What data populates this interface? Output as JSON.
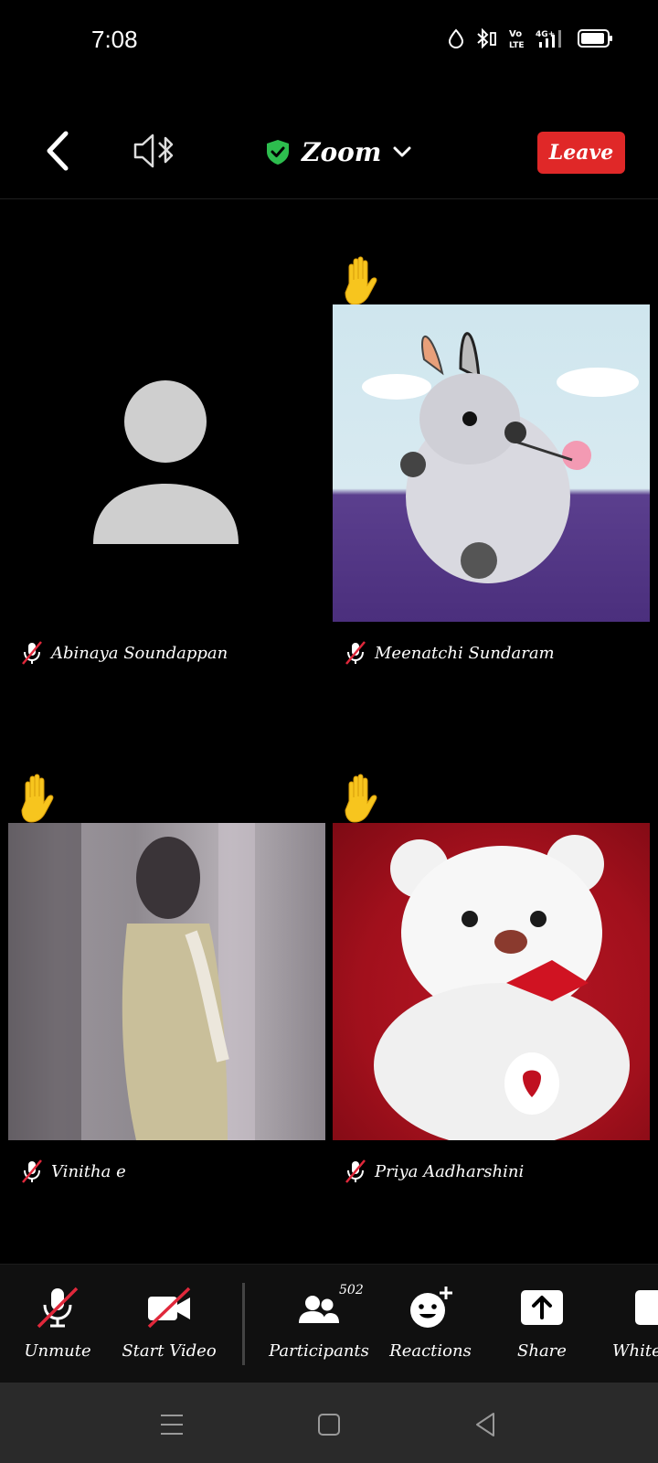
{
  "status": {
    "time": "7:08",
    "icons": [
      "data-saver-icon",
      "bluetooth-icon",
      "volte-icon",
      "4g-signal-icon",
      "battery-icon"
    ]
  },
  "toolbar": {
    "meeting_title": "Zoom",
    "leave_label": "Leave",
    "icons": [
      "back-arrow-icon",
      "bluetooth-speaker-icon",
      "shield-check-icon",
      "chevron-down-icon"
    ],
    "shield_color": "#2dbd4e",
    "leave_color": "#e02828"
  },
  "participants": [
    {
      "name": "Abinaya Soundappan",
      "muted": true,
      "hand_raised": false,
      "video": "avatar-placeholder"
    },
    {
      "name": "Meenatchi Sundaram",
      "muted": true,
      "hand_raised": true,
      "video": "bunny-image"
    },
    {
      "name": "Vinitha e",
      "muted": true,
      "hand_raised": true,
      "video": "camera-feed"
    },
    {
      "name": "Priya Aadharshini",
      "muted": true,
      "hand_raised": true,
      "video": "teddy-bear-image"
    }
  ],
  "bottombar": {
    "unmute_label": "Unmute",
    "start_video_label": "Start Video",
    "participants_label": "Participants",
    "participants_count": "502",
    "reactions_label": "Reactions",
    "share_label": "Share",
    "whiteboard_label": "White"
  },
  "navbar": {
    "icons": [
      "menu-icon",
      "home-square-icon",
      "back-triangle-icon"
    ]
  }
}
